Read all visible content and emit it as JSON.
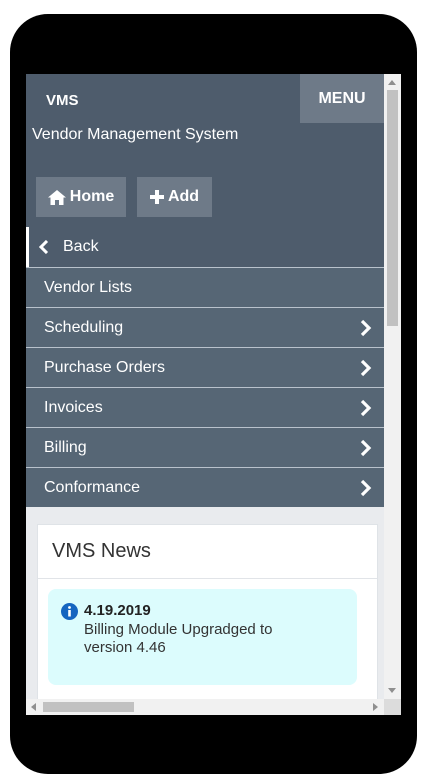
{
  "header": {
    "brand": "VMS",
    "subtitle": "Vendor Management System",
    "menu_label": "MENU",
    "home_label": "Home",
    "add_label": "Add"
  },
  "nav": {
    "back_label": "Back",
    "items": [
      {
        "label": "Vendor Lists",
        "has_submenu": false
      },
      {
        "label": "Scheduling",
        "has_submenu": true
      },
      {
        "label": "Purchase Orders",
        "has_submenu": true
      },
      {
        "label": "Invoices",
        "has_submenu": true
      },
      {
        "label": "Billing",
        "has_submenu": true
      },
      {
        "label": "Conformance",
        "has_submenu": true
      }
    ]
  },
  "news": {
    "title": "VMS News",
    "items": [
      {
        "date": "4.19.2019",
        "message": "Billing Module Upgradged to version 4.46"
      }
    ]
  },
  "colors": {
    "header_bg": "#4e5c6c",
    "button_bg": "#6e7a88",
    "nav_bg": "#566675",
    "alert_bg": "#dcfcfd",
    "info_icon": "#1565c0"
  },
  "icons": {
    "home": "home-icon",
    "add": "plus-icon",
    "back": "chevron-left-icon",
    "submenu": "chevron-right-icon",
    "info": "info-circle-icon"
  }
}
